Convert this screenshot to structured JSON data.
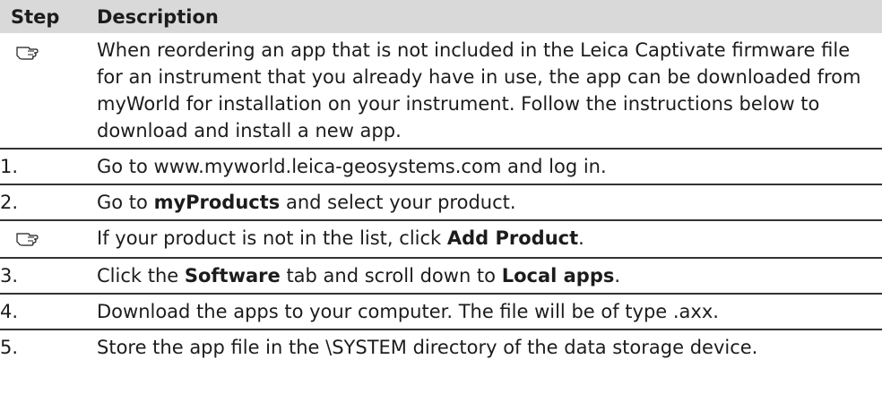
{
  "header": {
    "step": "Step",
    "description": "Description"
  },
  "rows": {
    "note1": {
      "icon": "pointing-hand-icon",
      "text": "When reordering an app that is not included in the Leica Captivate firmware file for an instrument that you already have in use, the app can be downloaded from myWorld for installation on your instrument. Follow the instructions below to download and install a new app."
    },
    "step1": {
      "num": "1.",
      "text": "Go to www.myworld.leica-geosystems.com and log in."
    },
    "step2": {
      "num": "2.",
      "pre": "Go to ",
      "bold": "myProducts",
      "post": " and select your product."
    },
    "note2": {
      "icon": "pointing-hand-icon",
      "pre": "If your product is not in the list, click ",
      "bold": "Add Product",
      "post": "."
    },
    "step3": {
      "num": "3.",
      "pre": "Click the ",
      "bold1": "Software",
      "mid": " tab and scroll down to ",
      "bold2": "Local apps",
      "post": "."
    },
    "step4": {
      "num": "4.",
      "text": "Download the apps to your computer. The file will be of type .axx."
    },
    "step5": {
      "num": "5.",
      "text": "Store the app file in the \\SYSTEM directory of the data storage device."
    }
  }
}
